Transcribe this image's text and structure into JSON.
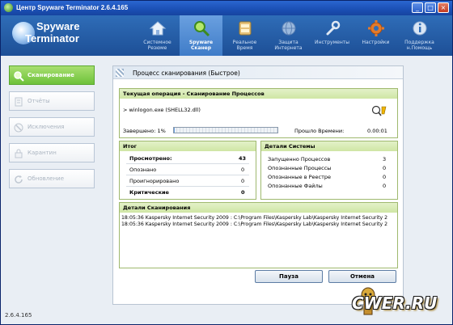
{
  "window": {
    "title": "Центр Spyware Terminator 2.6.4.165"
  },
  "logo": {
    "line1": "Spyware",
    "line2": "Terminator"
  },
  "nav": [
    {
      "line1": "Системное",
      "line2": "Резюме",
      "icon": "home-icon"
    },
    {
      "line1": "Spyware",
      "line2": "Сканер",
      "icon": "magnifier-icon"
    },
    {
      "line1": "Реальное",
      "line2": "Время",
      "icon": "clock-icon"
    },
    {
      "line1": "Защита",
      "line2": "Интернета",
      "icon": "globe-icon"
    },
    {
      "line1": "Инструменты",
      "line2": "",
      "icon": "wrench-icon"
    },
    {
      "line1": "Настройки",
      "line2": "",
      "icon": "gear-icon"
    },
    {
      "line1": "Поддержка",
      "line2": "н.Помощь",
      "icon": "info-icon"
    }
  ],
  "sidebar": [
    {
      "label": "Сканирование",
      "icon": "scan-icon"
    },
    {
      "label": "Отчёты",
      "icon": "report-icon"
    },
    {
      "label": "Исключения",
      "icon": "exclusions-icon"
    },
    {
      "label": "Карантин",
      "icon": "lock-icon"
    },
    {
      "label": "Обновление",
      "icon": "update-icon"
    }
  ],
  "version": "2.6.4.165",
  "panel": {
    "title": "Процесс сканирования (Быстрое)",
    "current_op": {
      "header": "Текущая операция - Сканирование Процессов",
      "file": "> winlogon.exe (SHELL32.dll)",
      "completed_label": "Завершено: 1%",
      "progress": 0.01,
      "elapsed_label": "Прошло Времени:",
      "elapsed_value": "0.00:01"
    },
    "summary": {
      "header": "Итог",
      "scanned_label": "Просмотрено:",
      "scanned_value": "43",
      "detected_label": "Опознано",
      "detected_value": "0",
      "ignored_label": "Проигнорировано",
      "ignored_value": "0",
      "critical_label": "Критические",
      "critical_value": "0"
    },
    "system": {
      "header": "Детали Системы",
      "running_label": "Запущенно Процессов",
      "running_value": "3",
      "id_proc_label": "Опознанные Процессы",
      "id_proc_value": "0",
      "registry_label": "Опознанные в Реестре",
      "registry_value": "0",
      "files_label": "Опознанные Файлы",
      "files_value": "0"
    },
    "details": {
      "header": "Детали Сканирования",
      "lines": [
        "18:05:36 Kaspersky Internet Security 2009 : C:\\Program Files\\Kaspersky Lab\\Kaspersky Internet Security 2",
        "18:05:36 Kaspersky Internet Security 2009 : C:\\Program Files\\Kaspersky Lab\\Kaspersky Internet Security 2"
      ]
    },
    "pause_label": "Пауза",
    "cancel_label": "Отмена"
  },
  "watermark": "CWER.RU"
}
